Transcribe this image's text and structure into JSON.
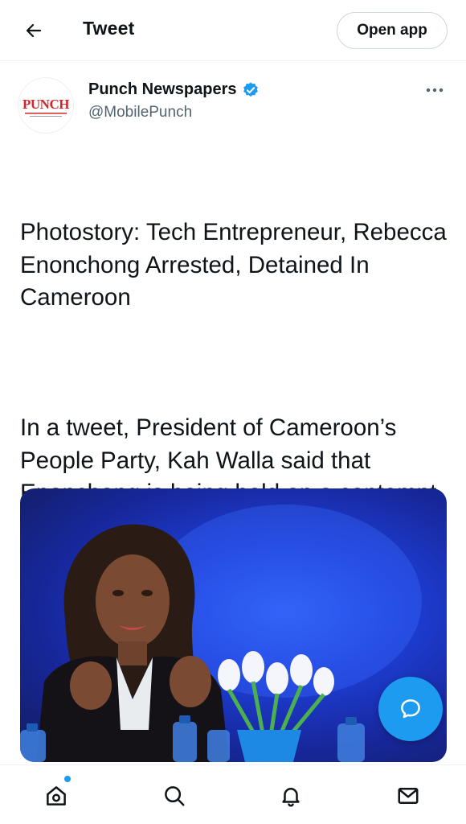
{
  "header": {
    "title": "Tweet",
    "open_app_label": "Open app"
  },
  "tweet": {
    "author": {
      "name": "Punch Newspapers",
      "handle": "@MobilePunch",
      "verified": true,
      "avatar_logo_text": "PUNCH"
    },
    "paragraphs": [
      "Photostory: Tech Entrepreneur, Rebecca Enonchong Arrested, Detained In Cameroon",
      "In a tweet, President of Cameroon’s People Party, Kah Walla said that Enonchong is being held on a contempt of court charge as alleged by the Attorney General of the country."
    ]
  },
  "icons": {
    "back": "arrow-left-icon",
    "more": "more-horizontal-icon",
    "verified": "verified-badge-icon",
    "compose": "reply-bubble-icon",
    "nav": [
      "home-icon",
      "search-icon",
      "bell-icon",
      "mail-icon"
    ]
  },
  "colors": {
    "accent": "#1d9bf0",
    "text": "#0f1419",
    "secondary_text": "#536471",
    "brand_red": "#d7262b"
  }
}
